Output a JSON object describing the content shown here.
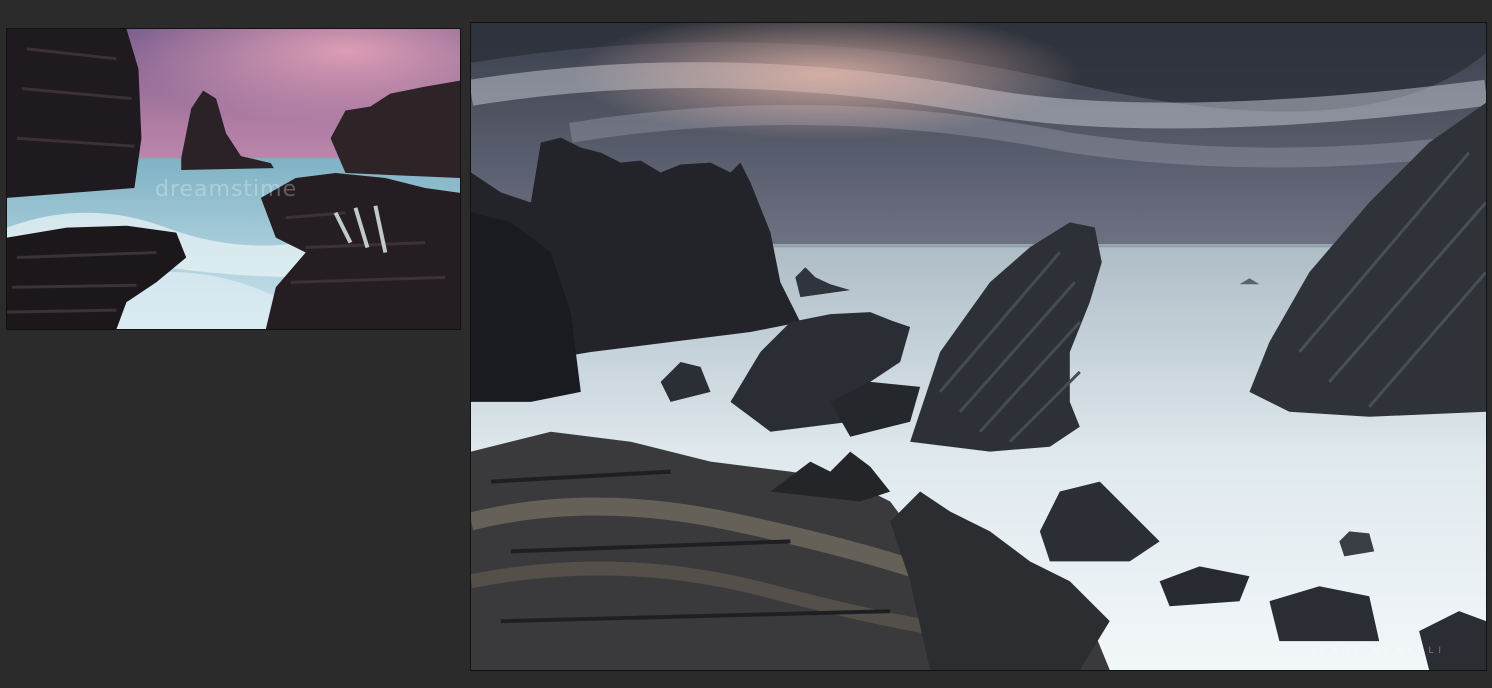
{
  "left_photo": {
    "watermark": "dreamstime"
  },
  "right_photo": {
    "watermark": "SERGE RAMELLI"
  },
  "colors": {
    "background": "#2b2b2b",
    "frame_border": "#111111"
  }
}
